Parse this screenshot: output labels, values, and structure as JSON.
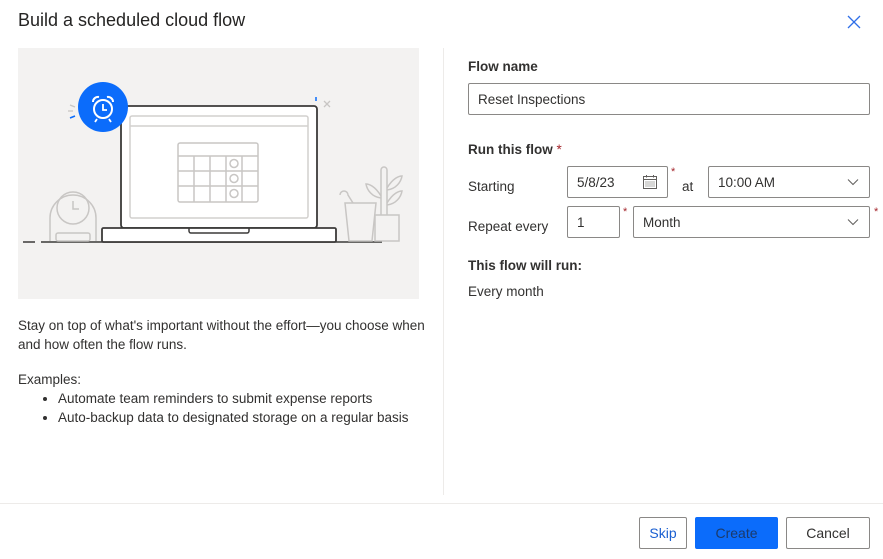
{
  "dialog": {
    "title": "Build a scheduled cloud flow",
    "close_icon": "close-icon"
  },
  "left": {
    "description": "Stay on top of what's important without the effort—you choose when and how often the flow runs.",
    "examples_label": "Examples:",
    "examples": [
      "Automate team reminders to submit expense reports",
      "Auto-backup data to designated storage on a regular basis"
    ],
    "illustration": {
      "accent_color": "#0b6cfb",
      "icons": [
        "alarm-clock-icon",
        "laptop",
        "calendar-grid",
        "desk-clock",
        "cup",
        "plant"
      ]
    }
  },
  "form": {
    "flow_name_label": "Flow name",
    "flow_name_value": "Reset Inspections",
    "run_this_flow_label": "Run this flow",
    "required_marker": "*",
    "starting_label": "Starting",
    "start_date_value": "5/8/23",
    "at_label": "at",
    "start_time_value": "10:00 AM",
    "repeat_every_label": "Repeat every",
    "interval_value": "1",
    "frequency_value": "Month",
    "summary_label": "This flow will run:",
    "summary_value": "Every month"
  },
  "footer": {
    "skip_label": "Skip",
    "create_label": "Create",
    "cancel_label": "Cancel"
  },
  "colors": {
    "primary": "#0b6cfb",
    "required": "#a4262c",
    "link": "#1a5fd1"
  }
}
